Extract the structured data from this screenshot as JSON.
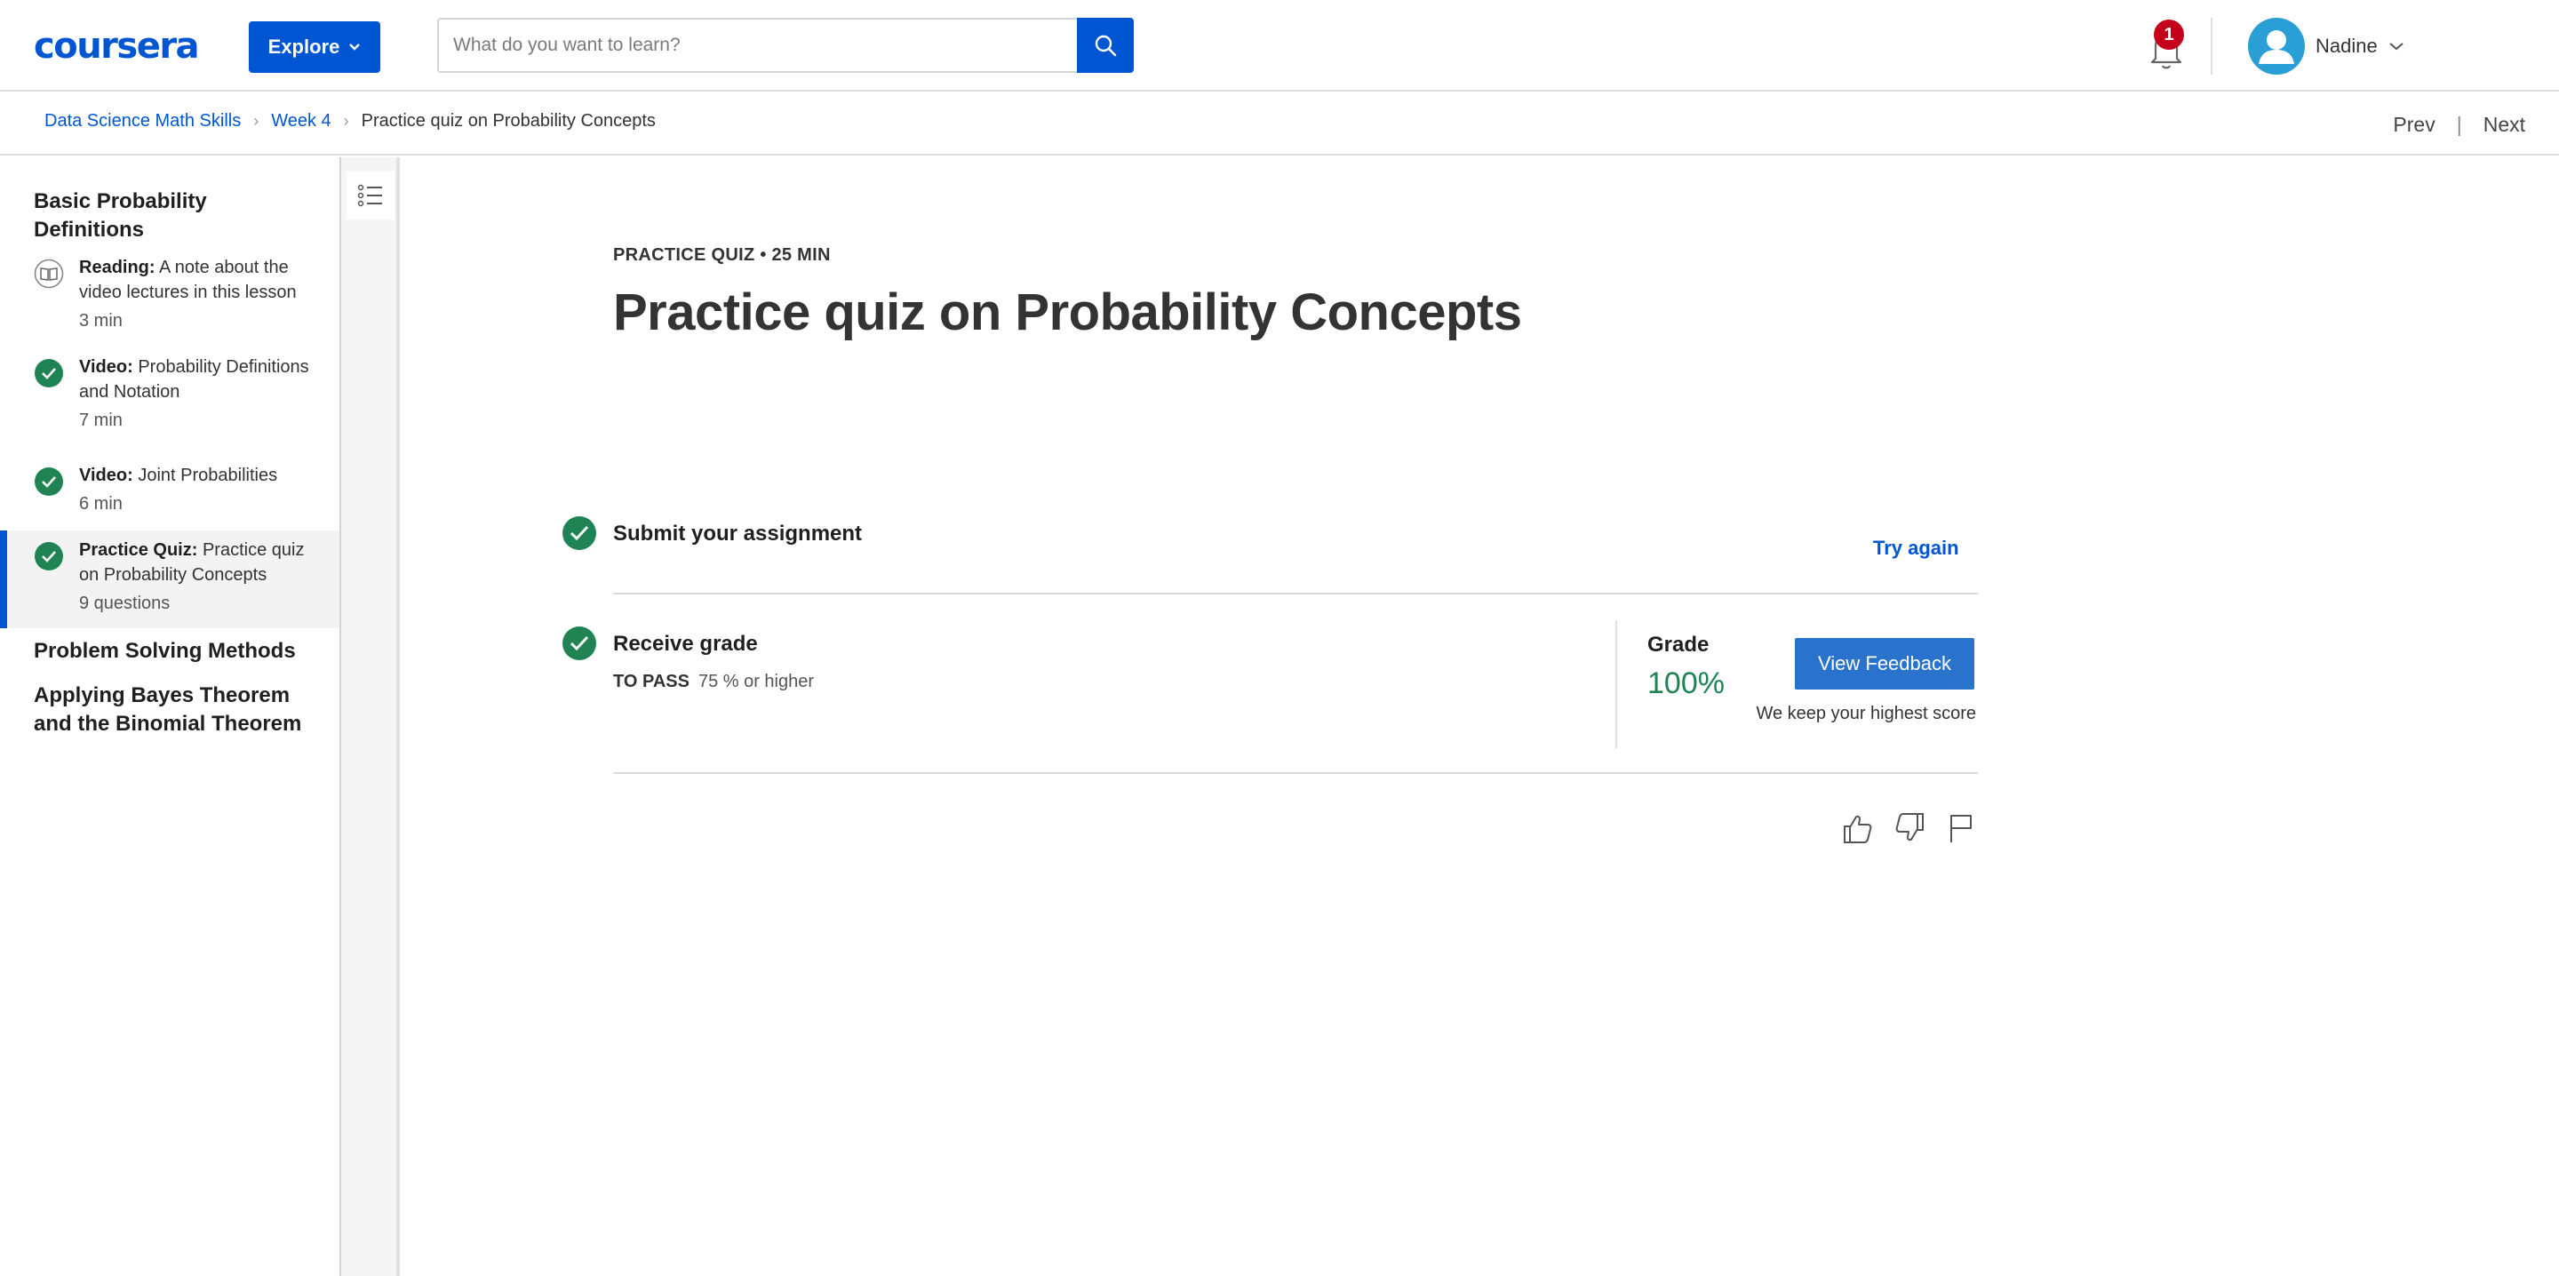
{
  "header": {
    "logo": "coursera",
    "explore_label": "Explore",
    "search_placeholder": "What do you want to learn?",
    "notifications_count": "1",
    "user_name": "Nadine",
    "accent_color": "#0056d2"
  },
  "breadcrumb": {
    "items": [
      "Data Science Math Skills",
      "Week 4",
      "Practice quiz on Probability Concepts"
    ],
    "prev": "Prev",
    "next": "Next"
  },
  "sidebar": {
    "section1": "Basic Probability Definitions",
    "items": [
      {
        "type": "Reading:",
        "title": "A note about the video lectures in this lesson",
        "meta": "3 min",
        "icon": "book-icon",
        "status": "not-completed"
      },
      {
        "type": "Video:",
        "title": "Probability Definitions and Notation",
        "meta": "7 min",
        "icon": "check-circle-icon",
        "status": "completed"
      },
      {
        "type": "Video:",
        "title": "Joint Probabilities",
        "meta": "6 min",
        "icon": "check-circle-icon",
        "status": "completed"
      },
      {
        "type": "Practice Quiz:",
        "title": "Practice quiz on Probability Concepts",
        "meta": "9 questions",
        "icon": "check-circle-icon",
        "status": "completed"
      }
    ],
    "section2": "Problem Solving Methods",
    "section3": "Applying Bayes Theorem and the Binomial Theorem"
  },
  "main": {
    "kicker": "PRACTICE QUIZ • 25 MIN",
    "title": "Practice quiz on Probability Concepts",
    "submit_title": "Submit your assignment",
    "try_again": "Try again",
    "receive_title": "Receive grade",
    "to_pass_label": "TO PASS",
    "to_pass_value": "75 % or higher",
    "grade_label": "Grade",
    "grade_value": "100%",
    "view_feedback": "View Feedback",
    "keep_score": "We keep your highest score",
    "success_color": "#1f8354"
  }
}
